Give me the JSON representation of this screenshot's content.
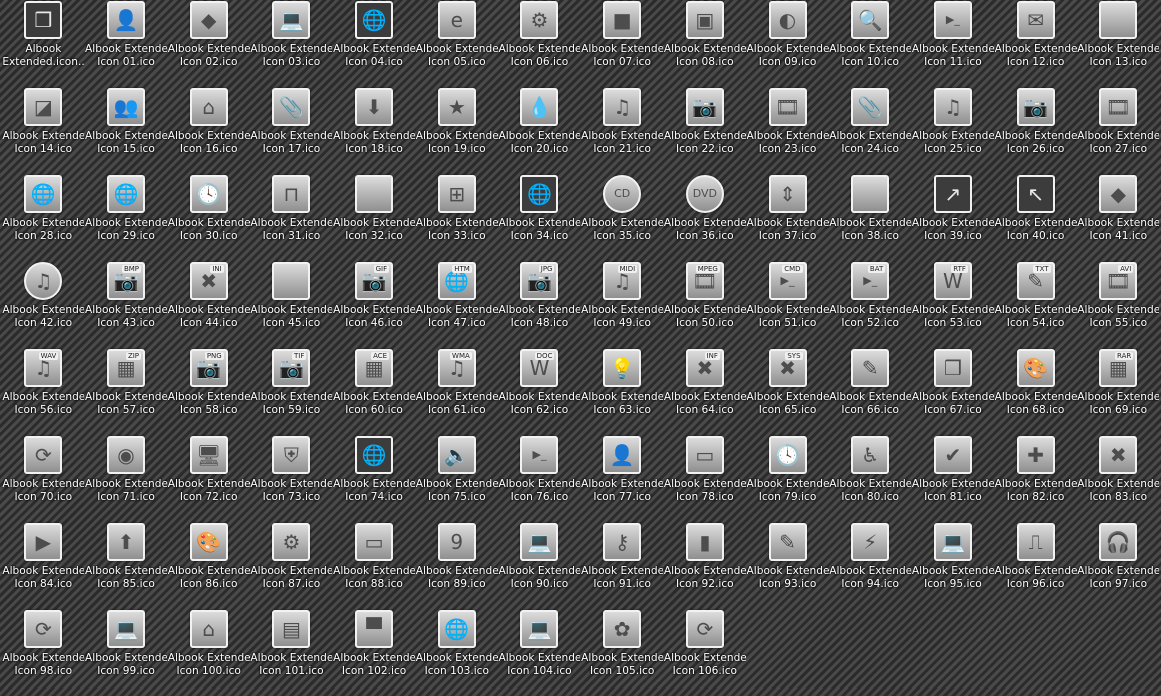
{
  "window": {
    "view": "icon grid"
  },
  "items": [
    {
      "l1": "Albook",
      "l2": "Extended.icon...",
      "icon": "app-box-icon",
      "glyph": "❒",
      "dark": true
    },
    {
      "l1": "Albook Extended",
      "l2": "Icon 01.ico",
      "icon": "user-icon",
      "glyph": "👤"
    },
    {
      "l1": "Albook Extended",
      "l2": "Icon 02.ico",
      "icon": "diamond-icon",
      "glyph": "◆"
    },
    {
      "l1": "Albook Extended",
      "l2": "Icon 03.ico",
      "icon": "laptop-icon",
      "glyph": "💻"
    },
    {
      "l1": "Albook Extended",
      "l2": "Icon 04.ico",
      "icon": "globe-icon",
      "glyph": "🌐",
      "dark": true
    },
    {
      "l1": "Albook Extended",
      "l2": "Icon 05.ico",
      "icon": "ie-icon",
      "glyph": "e"
    },
    {
      "l1": "Albook Extended",
      "l2": "Icon 06.ico",
      "icon": "gear-icon",
      "glyph": "⚙"
    },
    {
      "l1": "Albook Extended",
      "l2": "Icon 07.ico",
      "icon": "square-icon",
      "glyph": "■"
    },
    {
      "l1": "Albook Extended",
      "l2": "Icon 08.ico",
      "icon": "floppy-icon",
      "glyph": "▣"
    },
    {
      "l1": "Albook Extended",
      "l2": "Icon 09.ico",
      "icon": "pacman-icon",
      "glyph": "◐"
    },
    {
      "l1": "Albook Extended",
      "l2": "Icon 10.ico",
      "icon": "magnifier-icon",
      "glyph": "🔍"
    },
    {
      "l1": "Albook Extended",
      "l2": "Icon 11.ico",
      "icon": "terminal-icon",
      "glyph": "▶_"
    },
    {
      "l1": "Albook Extended",
      "l2": "Icon 12.ico",
      "icon": "mail-icon",
      "glyph": "✉"
    },
    {
      "l1": "Albook Extended",
      "l2": "Icon 13.ico",
      "icon": "blank-icon",
      "glyph": ""
    },
    {
      "l1": "Albook Extended",
      "l2": "Icon 14.ico",
      "icon": "diagonal-icon",
      "glyph": "◪"
    },
    {
      "l1": "Albook Extended",
      "l2": "Icon 15.ico",
      "icon": "users-icon",
      "glyph": "👥"
    },
    {
      "l1": "Albook Extended",
      "l2": "Icon 16.ico",
      "icon": "home-icon",
      "glyph": "⌂"
    },
    {
      "l1": "Albook Extended",
      "l2": "Icon 17.ico",
      "icon": "paperclip-icon",
      "glyph": "📎"
    },
    {
      "l1": "Albook Extended",
      "l2": "Icon 18.ico",
      "icon": "download-icon",
      "glyph": "⬇"
    },
    {
      "l1": "Albook Extended",
      "l2": "Icon 19.ico",
      "icon": "star-icon",
      "glyph": "★"
    },
    {
      "l1": "Albook Extended",
      "l2": "Icon 20.ico",
      "icon": "drop-icon",
      "glyph": "💧"
    },
    {
      "l1": "Albook Extended",
      "l2": "Icon 21.ico",
      "icon": "music-icon",
      "glyph": "♫"
    },
    {
      "l1": "Albook Extended",
      "l2": "Icon 22.ico",
      "icon": "camera-icon",
      "glyph": "📷"
    },
    {
      "l1": "Albook Extended",
      "l2": "Icon 23.ico",
      "icon": "film-icon",
      "glyph": "🎞"
    },
    {
      "l1": "Albook Extended",
      "l2": "Icon 24.ico",
      "icon": "paperclip-icon",
      "glyph": "📎"
    },
    {
      "l1": "Albook Extended",
      "l2": "Icon 25.ico",
      "icon": "music-icon",
      "glyph": "♫"
    },
    {
      "l1": "Albook Extended",
      "l2": "Icon 26.ico",
      "icon": "camera-icon",
      "glyph": "📷"
    },
    {
      "l1": "Albook Extended",
      "l2": "Icon 27.ico",
      "icon": "film-icon",
      "glyph": "🎞"
    },
    {
      "l1": "Albook Extended",
      "l2": "Icon 28.ico",
      "icon": "globe-icon",
      "glyph": "🌐"
    },
    {
      "l1": "Albook Extended",
      "l2": "Icon 29.ico",
      "icon": "globe-page-icon",
      "glyph": "🌐"
    },
    {
      "l1": "Albook Extended",
      "l2": "Icon 30.ico",
      "icon": "clock-icon",
      "glyph": "🕓"
    },
    {
      "l1": "Albook Extended",
      "l2": "Icon 31.ico",
      "icon": "floppy-icon",
      "glyph": "⊓"
    },
    {
      "l1": "Albook Extended",
      "l2": "Icon 32.ico",
      "icon": "blank-icon",
      "glyph": ""
    },
    {
      "l1": "Albook Extended",
      "l2": "Icon 33.ico",
      "icon": "windows-icon",
      "glyph": "⊞"
    },
    {
      "l1": "Albook Extended",
      "l2": "Icon 34.ico",
      "icon": "globe-icon",
      "glyph": "🌐",
      "dark": true
    },
    {
      "l1": "Albook Extended",
      "l2": "Icon 35.ico",
      "icon": "cd-icon",
      "glyph": "CD",
      "round": true
    },
    {
      "l1": "Albook Extended",
      "l2": "Icon 36.ico",
      "icon": "dvd-icon",
      "glyph": "DVD",
      "round": true
    },
    {
      "l1": "Albook Extended",
      "l2": "Icon 37.ico",
      "icon": "scroll-icon",
      "glyph": "⇕"
    },
    {
      "l1": "Albook Extended",
      "l2": "Icon 38.ico",
      "icon": "blank-icon",
      "glyph": ""
    },
    {
      "l1": "Albook Extended",
      "l2": "Icon 39.ico",
      "icon": "shortcut-icon",
      "glyph": "↗",
      "dark": true
    },
    {
      "l1": "Albook Extended",
      "l2": "Icon 40.ico",
      "icon": "shortcut-icon",
      "glyph": "↖",
      "dark": true
    },
    {
      "l1": "Albook Extended",
      "l2": "Icon 41.ico",
      "icon": "diamond-icon",
      "glyph": "◆"
    },
    {
      "l1": "Albook Extended",
      "l2": "Icon 42.ico",
      "icon": "cd-music-icon",
      "glyph": "♫",
      "round": true
    },
    {
      "l1": "Albook Extended",
      "l2": "Icon 43.ico",
      "icon": "bmp-file-icon",
      "glyph": "📷",
      "badge": "BMP"
    },
    {
      "l1": "Albook Extended",
      "l2": "Icon 44.ico",
      "icon": "ini-file-icon",
      "glyph": "✖",
      "badge": "INI"
    },
    {
      "l1": "Albook Extended",
      "l2": "Icon 45.ico",
      "icon": "page-icon",
      "glyph": ""
    },
    {
      "l1": "Albook Extended",
      "l2": "Icon 46.ico",
      "icon": "gif-file-icon",
      "glyph": "📷",
      "badge": "GIF"
    },
    {
      "l1": "Albook Extended",
      "l2": "Icon 47.ico",
      "icon": "htm-file-icon",
      "glyph": "🌐",
      "badge": "HTM"
    },
    {
      "l1": "Albook Extended",
      "l2": "Icon 48.ico",
      "icon": "jpg-file-icon",
      "glyph": "📷",
      "badge": "JPG"
    },
    {
      "l1": "Albook Extended",
      "l2": "Icon 49.ico",
      "icon": "midi-file-icon",
      "glyph": "♫",
      "badge": "MIDI"
    },
    {
      "l1": "Albook Extended",
      "l2": "Icon 50.ico",
      "icon": "mpeg-file-icon",
      "glyph": "🎞",
      "badge": "MPEG"
    },
    {
      "l1": "Albook Extended",
      "l2": "Icon 51.ico",
      "icon": "cmd-file-icon",
      "glyph": "▶_",
      "badge": "CMD"
    },
    {
      "l1": "Albook Extended",
      "l2": "Icon 52.ico",
      "icon": "bat-file-icon",
      "glyph": "▶_",
      "badge": "BAT"
    },
    {
      "l1": "Albook Extended",
      "l2": "Icon 53.ico",
      "icon": "rtf-file-icon",
      "glyph": "W",
      "badge": "RTF"
    },
    {
      "l1": "Albook Extended",
      "l2": "Icon 54.ico",
      "icon": "txt-file-icon",
      "glyph": "✎",
      "badge": "TXT"
    },
    {
      "l1": "Albook Extended",
      "l2": "Icon 55.ico",
      "icon": "avi-file-icon",
      "glyph": "🎞",
      "badge": "AVI"
    },
    {
      "l1": "Albook Extended",
      "l2": "Icon 56.ico",
      "icon": "wav-file-icon",
      "glyph": "♫",
      "badge": "WAV"
    },
    {
      "l1": "Albook Extended",
      "l2": "Icon 57.ico",
      "icon": "zip-file-icon",
      "glyph": "▦",
      "badge": "ZIP"
    },
    {
      "l1": "Albook Extended",
      "l2": "Icon 58.ico",
      "icon": "png-file-icon",
      "glyph": "📷",
      "badge": "PNG"
    },
    {
      "l1": "Albook Extended",
      "l2": "Icon 59.ico",
      "icon": "tif-file-icon",
      "glyph": "📷",
      "badge": "TIF"
    },
    {
      "l1": "Albook Extended",
      "l2": "Icon 60.ico",
      "icon": "ace-file-icon",
      "glyph": "▦",
      "badge": "ACE"
    },
    {
      "l1": "Albook Extended",
      "l2": "Icon 61.ico",
      "icon": "wma-file-icon",
      "glyph": "♫",
      "badge": "WMA"
    },
    {
      "l1": "Albook Extended",
      "l2": "Icon 62.ico",
      "icon": "doc-file-icon",
      "glyph": "W",
      "badge": "DOC"
    },
    {
      "l1": "Albook Extended",
      "l2": "Icon 63.ico",
      "icon": "lightbulb-icon",
      "glyph": "💡"
    },
    {
      "l1": "Albook Extended",
      "l2": "Icon 64.ico",
      "icon": "inf-file-icon",
      "glyph": "✖",
      "badge": "INF"
    },
    {
      "l1": "Albook Extended",
      "l2": "Icon 65.ico",
      "icon": "sys-file-icon",
      "glyph": "✖",
      "badge": "SYS"
    },
    {
      "l1": "Albook Extended",
      "l2": "Icon 66.ico",
      "icon": "pencil-ruler-icon",
      "glyph": "✎"
    },
    {
      "l1": "Albook Extended",
      "l2": "Icon 67.ico",
      "icon": "box-icon",
      "glyph": "❒"
    },
    {
      "l1": "Albook Extended",
      "l2": "Icon 68.ico",
      "icon": "palette-icon",
      "glyph": "🎨"
    },
    {
      "l1": "Albook Extended",
      "l2": "Icon 69.ico",
      "icon": "rar-file-icon",
      "glyph": "▦",
      "badge": "RAR"
    },
    {
      "l1": "Albook Extended",
      "l2": "Icon 70.ico",
      "icon": "refresh-icon",
      "glyph": "⟳"
    },
    {
      "l1": "Albook Extended",
      "l2": "Icon 71.ico",
      "icon": "firefox-icon",
      "glyph": "◉"
    },
    {
      "l1": "Albook Extended",
      "l2": "Icon 72.ico",
      "icon": "monitor-chart-icon",
      "glyph": "🖥"
    },
    {
      "l1": "Albook Extended",
      "l2": "Icon 73.ico",
      "icon": "shield-icon",
      "glyph": "⛨"
    },
    {
      "l1": "Albook Extended",
      "l2": "Icon 74.ico",
      "icon": "globe-icon",
      "glyph": "🌐",
      "dark": true
    },
    {
      "l1": "Albook Extended",
      "l2": "Icon 75.ico",
      "icon": "speaker-icon",
      "glyph": "🔈"
    },
    {
      "l1": "Albook Extended",
      "l2": "Icon 76.ico",
      "icon": "terminal-window-icon",
      "glyph": "▶_"
    },
    {
      "l1": "Albook Extended",
      "l2": "Icon 77.ico",
      "icon": "user-card-icon",
      "glyph": "👤"
    },
    {
      "l1": "Albook Extended",
      "l2": "Icon 78.ico",
      "icon": "window-icon",
      "glyph": "▭"
    },
    {
      "l1": "Albook Extended",
      "l2": "Icon 79.ico",
      "icon": "clock-icon",
      "glyph": "🕓"
    },
    {
      "l1": "Albook Extended",
      "l2": "Icon 80.ico",
      "icon": "wheelchair-icon",
      "glyph": "♿"
    },
    {
      "l1": "Albook Extended",
      "l2": "Icon 81.ico",
      "icon": "check-icon",
      "glyph": "✔"
    },
    {
      "l1": "Albook Extended",
      "l2": "Icon 82.ico",
      "icon": "plus-icon",
      "glyph": "✚"
    },
    {
      "l1": "Albook Extended",
      "l2": "Icon 83.ico",
      "icon": "tools-icon",
      "glyph": "✖"
    },
    {
      "l1": "Albook Extended",
      "l2": "Icon 84.ico",
      "icon": "media-player-icon",
      "glyph": "▶"
    },
    {
      "l1": "Albook Extended",
      "l2": "Icon 85.ico",
      "icon": "upload-icon",
      "glyph": "⬆"
    },
    {
      "l1": "Albook Extended",
      "l2": "Icon 86.ico",
      "icon": "palette-icon",
      "glyph": "🎨"
    },
    {
      "l1": "Albook Extended",
      "l2": "Icon 87.ico",
      "icon": "gear-icon",
      "glyph": "⚙"
    },
    {
      "l1": "Albook Extended",
      "l2": "Icon 88.ico",
      "icon": "window-icon",
      "glyph": "▭"
    },
    {
      "l1": "Albook Extended",
      "l2": "Icon 89.ico",
      "icon": "number-nine-icon",
      "glyph": "9"
    },
    {
      "l1": "Albook Extended",
      "l2": "Icon 90.ico",
      "icon": "laptop-icon",
      "glyph": "💻"
    },
    {
      "l1": "Albook Extended",
      "l2": "Icon 91.ico",
      "icon": "keyhole-icon",
      "glyph": "⚷"
    },
    {
      "l1": "Albook Extended",
      "l2": "Icon 92.ico",
      "icon": "equalizer-icon",
      "glyph": "▮"
    },
    {
      "l1": "Albook Extended",
      "l2": "Icon 93.ico",
      "icon": "pencil-ruler-icon",
      "glyph": "✎"
    },
    {
      "l1": "Albook Extended",
      "l2": "Icon 94.ico",
      "icon": "lightning-icon",
      "glyph": "⚡"
    },
    {
      "l1": "Albook Extended",
      "l2": "Icon 95.ico",
      "icon": "laptop-icon",
      "glyph": "💻"
    },
    {
      "l1": "Albook Extended",
      "l2": "Icon 96.ico",
      "icon": "scanner-icon",
      "glyph": "⎍"
    },
    {
      "l1": "Albook Extended",
      "l2": "Icon 97.ico",
      "icon": "headphones-icon",
      "glyph": "🎧"
    },
    {
      "l1": "Albook Extended",
      "l2": "Icon 98.ico",
      "icon": "refresh-icon",
      "glyph": "⟳"
    },
    {
      "l1": "Albook Extended",
      "l2": "Icon 99.ico",
      "icon": "laptop-icon",
      "glyph": "💻"
    },
    {
      "l1": "Albook Extended",
      "l2": "Icon 100.ico",
      "icon": "home-icon",
      "glyph": "⌂"
    },
    {
      "l1": "Albook Extended",
      "l2": "Icon 101.ico",
      "icon": "id-card-icon",
      "glyph": "▤"
    },
    {
      "l1": "Albook Extended",
      "l2": "Icon 102.ico",
      "icon": "clapper-icon",
      "glyph": "▀"
    },
    {
      "l1": "Albook Extended",
      "l2": "Icon 103.ico",
      "icon": "globe-grid-icon",
      "glyph": "🌐"
    },
    {
      "l1": "Albook Extended",
      "l2": "Icon 104.ico",
      "icon": "laptop-icon",
      "glyph": "💻"
    },
    {
      "l1": "Albook Extended",
      "l2": "Icon 105.ico",
      "icon": "flower-icon",
      "glyph": "✿"
    },
    {
      "l1": "Albook Extended",
      "l2": "Icon 106.ico",
      "icon": "refresh-icon",
      "glyph": "⟳"
    }
  ]
}
